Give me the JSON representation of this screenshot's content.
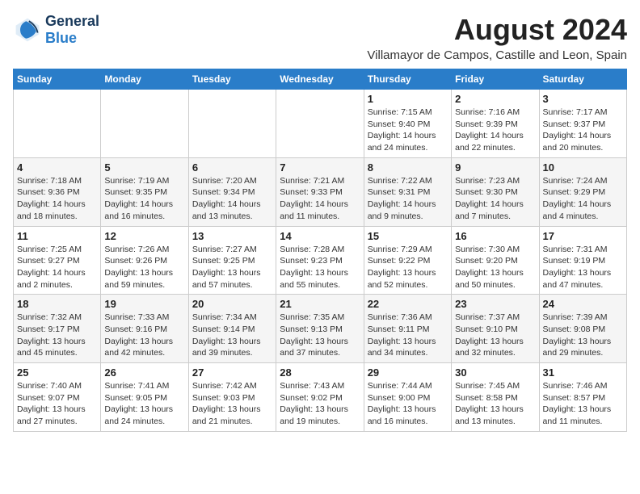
{
  "header": {
    "logo_line1": "General",
    "logo_line2": "Blue",
    "month_year": "August 2024",
    "location": "Villamayor de Campos, Castille and Leon, Spain"
  },
  "days_of_week": [
    "Sunday",
    "Monday",
    "Tuesday",
    "Wednesday",
    "Thursday",
    "Friday",
    "Saturday"
  ],
  "weeks": [
    [
      {
        "day": "",
        "info": ""
      },
      {
        "day": "",
        "info": ""
      },
      {
        "day": "",
        "info": ""
      },
      {
        "day": "",
        "info": ""
      },
      {
        "day": "1",
        "info": "Sunrise: 7:15 AM\nSunset: 9:40 PM\nDaylight: 14 hours\nand 24 minutes."
      },
      {
        "day": "2",
        "info": "Sunrise: 7:16 AM\nSunset: 9:39 PM\nDaylight: 14 hours\nand 22 minutes."
      },
      {
        "day": "3",
        "info": "Sunrise: 7:17 AM\nSunset: 9:37 PM\nDaylight: 14 hours\nand 20 minutes."
      }
    ],
    [
      {
        "day": "4",
        "info": "Sunrise: 7:18 AM\nSunset: 9:36 PM\nDaylight: 14 hours\nand 18 minutes."
      },
      {
        "day": "5",
        "info": "Sunrise: 7:19 AM\nSunset: 9:35 PM\nDaylight: 14 hours\nand 16 minutes."
      },
      {
        "day": "6",
        "info": "Sunrise: 7:20 AM\nSunset: 9:34 PM\nDaylight: 14 hours\nand 13 minutes."
      },
      {
        "day": "7",
        "info": "Sunrise: 7:21 AM\nSunset: 9:33 PM\nDaylight: 14 hours\nand 11 minutes."
      },
      {
        "day": "8",
        "info": "Sunrise: 7:22 AM\nSunset: 9:31 PM\nDaylight: 14 hours\nand 9 minutes."
      },
      {
        "day": "9",
        "info": "Sunrise: 7:23 AM\nSunset: 9:30 PM\nDaylight: 14 hours\nand 7 minutes."
      },
      {
        "day": "10",
        "info": "Sunrise: 7:24 AM\nSunset: 9:29 PM\nDaylight: 14 hours\nand 4 minutes."
      }
    ],
    [
      {
        "day": "11",
        "info": "Sunrise: 7:25 AM\nSunset: 9:27 PM\nDaylight: 14 hours\nand 2 minutes."
      },
      {
        "day": "12",
        "info": "Sunrise: 7:26 AM\nSunset: 9:26 PM\nDaylight: 13 hours\nand 59 minutes."
      },
      {
        "day": "13",
        "info": "Sunrise: 7:27 AM\nSunset: 9:25 PM\nDaylight: 13 hours\nand 57 minutes."
      },
      {
        "day": "14",
        "info": "Sunrise: 7:28 AM\nSunset: 9:23 PM\nDaylight: 13 hours\nand 55 minutes."
      },
      {
        "day": "15",
        "info": "Sunrise: 7:29 AM\nSunset: 9:22 PM\nDaylight: 13 hours\nand 52 minutes."
      },
      {
        "day": "16",
        "info": "Sunrise: 7:30 AM\nSunset: 9:20 PM\nDaylight: 13 hours\nand 50 minutes."
      },
      {
        "day": "17",
        "info": "Sunrise: 7:31 AM\nSunset: 9:19 PM\nDaylight: 13 hours\nand 47 minutes."
      }
    ],
    [
      {
        "day": "18",
        "info": "Sunrise: 7:32 AM\nSunset: 9:17 PM\nDaylight: 13 hours\nand 45 minutes."
      },
      {
        "day": "19",
        "info": "Sunrise: 7:33 AM\nSunset: 9:16 PM\nDaylight: 13 hours\nand 42 minutes."
      },
      {
        "day": "20",
        "info": "Sunrise: 7:34 AM\nSunset: 9:14 PM\nDaylight: 13 hours\nand 39 minutes."
      },
      {
        "day": "21",
        "info": "Sunrise: 7:35 AM\nSunset: 9:13 PM\nDaylight: 13 hours\nand 37 minutes."
      },
      {
        "day": "22",
        "info": "Sunrise: 7:36 AM\nSunset: 9:11 PM\nDaylight: 13 hours\nand 34 minutes."
      },
      {
        "day": "23",
        "info": "Sunrise: 7:37 AM\nSunset: 9:10 PM\nDaylight: 13 hours\nand 32 minutes."
      },
      {
        "day": "24",
        "info": "Sunrise: 7:39 AM\nSunset: 9:08 PM\nDaylight: 13 hours\nand 29 minutes."
      }
    ],
    [
      {
        "day": "25",
        "info": "Sunrise: 7:40 AM\nSunset: 9:07 PM\nDaylight: 13 hours\nand 27 minutes."
      },
      {
        "day": "26",
        "info": "Sunrise: 7:41 AM\nSunset: 9:05 PM\nDaylight: 13 hours\nand 24 minutes."
      },
      {
        "day": "27",
        "info": "Sunrise: 7:42 AM\nSunset: 9:03 PM\nDaylight: 13 hours\nand 21 minutes."
      },
      {
        "day": "28",
        "info": "Sunrise: 7:43 AM\nSunset: 9:02 PM\nDaylight: 13 hours\nand 19 minutes."
      },
      {
        "day": "29",
        "info": "Sunrise: 7:44 AM\nSunset: 9:00 PM\nDaylight: 13 hours\nand 16 minutes."
      },
      {
        "day": "30",
        "info": "Sunrise: 7:45 AM\nSunset: 8:58 PM\nDaylight: 13 hours\nand 13 minutes."
      },
      {
        "day": "31",
        "info": "Sunrise: 7:46 AM\nSunset: 8:57 PM\nDaylight: 13 hours\nand 11 minutes."
      }
    ]
  ]
}
